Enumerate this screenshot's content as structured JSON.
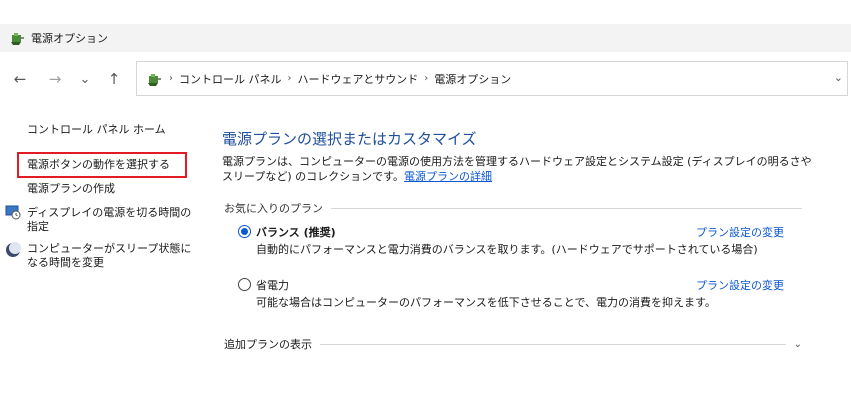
{
  "window": {
    "title": "電源オプション",
    "icon": "power-options-icon"
  },
  "nav": {
    "back": "←",
    "forward": "→",
    "recent": "⌄",
    "up": "↑",
    "breadcrumb": [
      "コントロール パネル",
      "ハードウェアとサウンド",
      "電源オプション"
    ],
    "separator": "›",
    "dropdown": "⌄"
  },
  "sidebar": {
    "home": "コントロール パネル ホーム",
    "items": [
      {
        "label": "電源ボタンの動作を選択する"
      },
      {
        "label": "電源プランの作成"
      },
      {
        "label": "ディスプレイの電源を切る時間の指定",
        "icon": "display-timer-icon"
      },
      {
        "label": "コンピューターがスリープ状態になる時間を変更",
        "icon": "sleep-moon-icon"
      }
    ]
  },
  "main": {
    "title": "電源プランの選択またはカスタマイズ",
    "description": "電源プランは、コンピューターの電源の使用方法を管理するハードウェア設定とシステム設定 (ディスプレイの明るさやスリープなど) のコレクションです。",
    "details_link": "電源プランの詳細",
    "favorites_label": "お気に入りのプラン",
    "plans": [
      {
        "name": "バランス (推奨)",
        "selected": true,
        "description": "自動的にパフォーマンスと電力消費のバランスを取ります。(ハードウェアでサポートされている場合)",
        "link": "プラン設定の変更"
      },
      {
        "name": "省電力",
        "selected": false,
        "description": "可能な場合はコンピューターのパフォーマンスを低下させることで、電力の消費を抑えます。",
        "link": "プラン設定の変更"
      }
    ],
    "more_plans": "追加プランの表示",
    "more_chevron": "⌄"
  },
  "colors": {
    "link": "#0b57d0",
    "title": "#1f4e9c",
    "highlight": "#e31b23"
  }
}
